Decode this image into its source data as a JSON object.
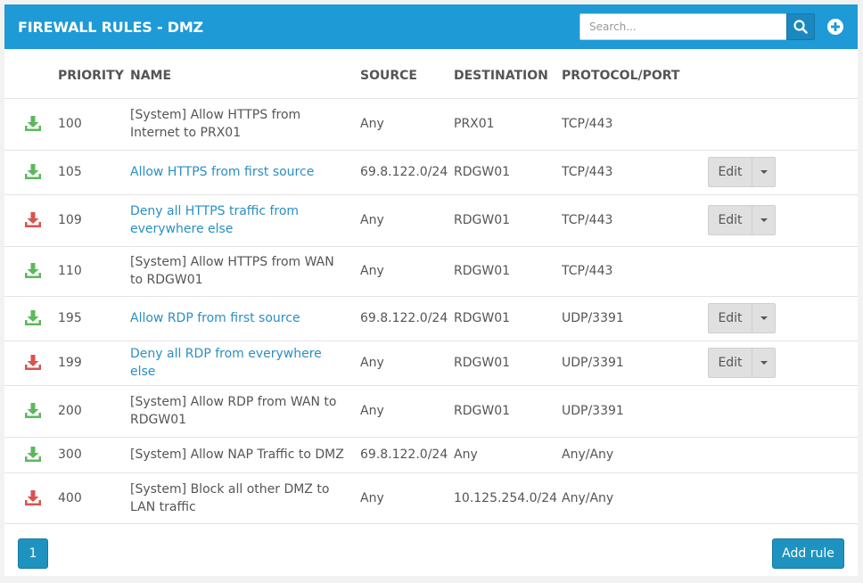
{
  "header": {
    "title": "FIREWALL RULES - DMZ",
    "search_placeholder": "Search...",
    "search_value": ""
  },
  "columns": {
    "priority": "PRIORITY",
    "name": "NAME",
    "source": "SOURCE",
    "destination": "DESTINATION",
    "protocol": "PROTOCOL/PORT"
  },
  "colors": {
    "allow": "#5cb85c",
    "deny": "#d9534f",
    "header_bg": "#1e9ad6",
    "link": "#2a8fc3"
  },
  "rules": [
    {
      "icon": "download-allow-icon",
      "action": "allow",
      "priority": "100",
      "name": "[System] Allow HTTPS from Internet to PRX01",
      "link": false,
      "source": "Any",
      "destination": "PRX01",
      "protocol": "TCP/443",
      "editable": false
    },
    {
      "icon": "download-allow-icon",
      "action": "allow",
      "priority": "105",
      "name": "Allow HTTPS from first source",
      "link": true,
      "source": "69.8.122.0/24",
      "destination": "RDGW01",
      "protocol": "TCP/443",
      "editable": true
    },
    {
      "icon": "download-deny-icon",
      "action": "deny",
      "priority": "109",
      "name": "Deny all HTTPS traffic from everywhere else",
      "link": true,
      "source": "Any",
      "destination": "RDGW01",
      "protocol": "TCP/443",
      "editable": true
    },
    {
      "icon": "download-allow-icon",
      "action": "allow",
      "priority": "110",
      "name": "[System] Allow HTTPS from WAN to RDGW01",
      "link": false,
      "source": "Any",
      "destination": "RDGW01",
      "protocol": "TCP/443",
      "editable": false
    },
    {
      "icon": "download-allow-icon",
      "action": "allow",
      "priority": "195",
      "name": "Allow RDP from first source",
      "link": true,
      "source": "69.8.122.0/24",
      "destination": "RDGW01",
      "protocol": "UDP/3391",
      "editable": true
    },
    {
      "icon": "download-deny-icon",
      "action": "deny",
      "priority": "199",
      "name": "Deny all RDP from everywhere else",
      "link": true,
      "source": "Any",
      "destination": "RDGW01",
      "protocol": "UDP/3391",
      "editable": true
    },
    {
      "icon": "download-allow-icon",
      "action": "allow",
      "priority": "200",
      "name": "[System] Allow RDP from WAN to RDGW01",
      "link": false,
      "source": "Any",
      "destination": "RDGW01",
      "protocol": "UDP/3391",
      "editable": false
    },
    {
      "icon": "download-allow-icon",
      "action": "allow",
      "priority": "300",
      "name": "[System] Allow NAP Traffic to DMZ",
      "link": false,
      "source": "69.8.122.0/24",
      "destination": "Any",
      "protocol": "Any/Any",
      "editable": false
    },
    {
      "icon": "download-deny-icon",
      "action": "deny",
      "priority": "400",
      "name": "[System] Block all other DMZ to LAN traffic",
      "link": false,
      "source": "Any",
      "destination": "10.125.254.0/24",
      "protocol": "Any/Any",
      "editable": false
    }
  ],
  "row_actions": {
    "edit_label": "Edit"
  },
  "footer": {
    "page": "1",
    "add_rule_label": "Add rule"
  }
}
